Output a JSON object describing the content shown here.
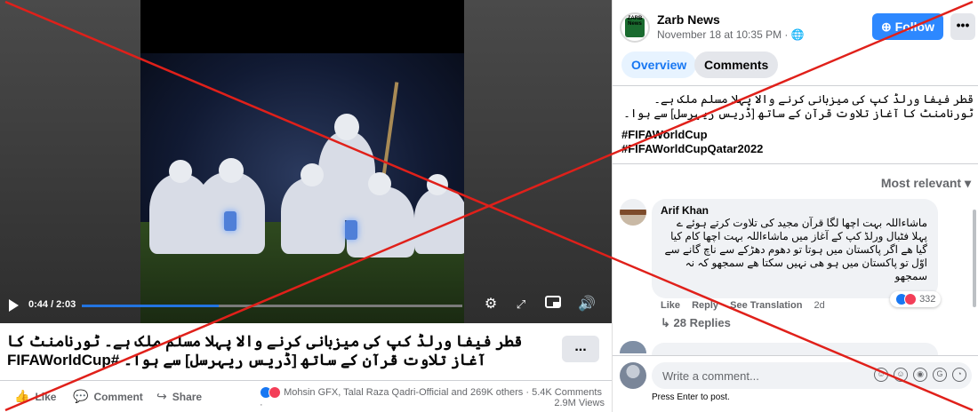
{
  "video": {
    "time": "0:44 / 2:03",
    "progress_fraction": 0.36
  },
  "post": {
    "caption": "قطر فیفا ورلڈ کپ کی میزبانی کرنے والا پہلا مسلم ملک ہے۔ ٹورنامنٹ کا آغاز تلاوت قرآن کے ساتھ [ڈریس ریہرسل] سے ہوا۔ #FIFAWorldCup",
    "more_label": "...",
    "actions": {
      "like": "Like",
      "comment": "Comment",
      "share": "Share"
    },
    "reactions_text": "Mohsin GFX, Talal Raza Qadri-Official and 269K others",
    "comments_count": "5.4K Comments",
    "views": "2.9M Views"
  },
  "panel": {
    "page_name": "Zarb News",
    "avatar_text": "ZARB News",
    "date": "November 18 at 10:35 PM",
    "follow_label": "Follow",
    "more_label": "•••",
    "tabs": [
      "Overview",
      "Comments"
    ],
    "post_text": "قطر فیفا ورلڈ کپ کی میزبانی کرنے والا پہلا مسلم ملک ہے۔ ٹورنامنٹ کا آغاز تلاوت قرآن کے ساتھ [ڈریس ریہرسل] سے ہوا۔",
    "hashtags": [
      "#FIFAWorldCup",
      "#FIFAWorldCupQatar2022"
    ],
    "sort_label": "Most relevant ▾",
    "comment": {
      "author": "Arif Khan",
      "text": "ماشاءاللہ بہت اچھا لگا قرآن مجید کی تلاوت کرتے ہوئے ے پہلا فٹبال ورلڈ کپ کے آغاز میں ماشاءاللہ بہت اچھا کام کیا گیا ھے اگر پاکستان میں ہوتا تو دھوم دھڑکے سے ناچ گانے سے اوّل تو پاکستان میں ہو ھی نہیں سکتا ھے سمجھو کہ نہ سمجھو",
      "reactions": "332",
      "actions": [
        "Like",
        "Reply",
        "See Translation"
      ],
      "time": "2d",
      "replies": "28 Replies"
    },
    "composer_placeholder": "Write a comment...",
    "composer_hint": "Press Enter to post."
  },
  "colors": {
    "accent": "#1877f2",
    "follow_bg": "#2d88ff",
    "overlay_red": "#e0201a"
  }
}
